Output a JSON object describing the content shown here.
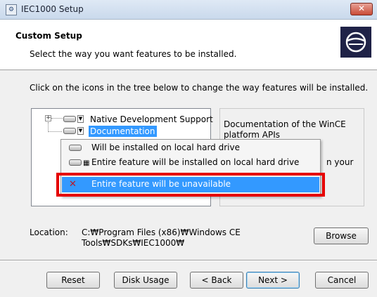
{
  "window": {
    "title": "IEC1000 Setup",
    "close_glyph": "✕"
  },
  "header": {
    "title": "Custom Setup",
    "subtitle": "Select the way you want features to be installed."
  },
  "instruction": "Click on the icons in the tree below to change the way features will be installed.",
  "tree": {
    "items": [
      {
        "label": "Native Development Support",
        "expander": "+"
      },
      {
        "label": "Documentation",
        "selected": true
      }
    ]
  },
  "description": {
    "text": "Documentation of the WinCE platform APIs",
    "tail": "n your"
  },
  "menu": {
    "items": [
      {
        "label": "Will be installed on local hard drive",
        "icon": "drive-icon"
      },
      {
        "label": "Entire feature will be installed on local hard drive",
        "icon": "drive-tree-icon"
      },
      {
        "label": "Entire feature will be unavailable",
        "icon": "x-icon",
        "selected": true
      }
    ]
  },
  "location": {
    "label": "Location:",
    "line1": "C:₩Program Files (x86)₩Windows CE",
    "line2": "Tools₩SDKs₩IEC1000₩"
  },
  "buttons": {
    "browse": "Browse",
    "reset": "Reset",
    "disk_usage": "Disk Usage",
    "back": "< Back",
    "next": "Next >",
    "cancel": "Cancel"
  },
  "colors": {
    "selection": "#3399ff",
    "highlight_box": "#e60000",
    "logo_bg": "#1f2247"
  }
}
